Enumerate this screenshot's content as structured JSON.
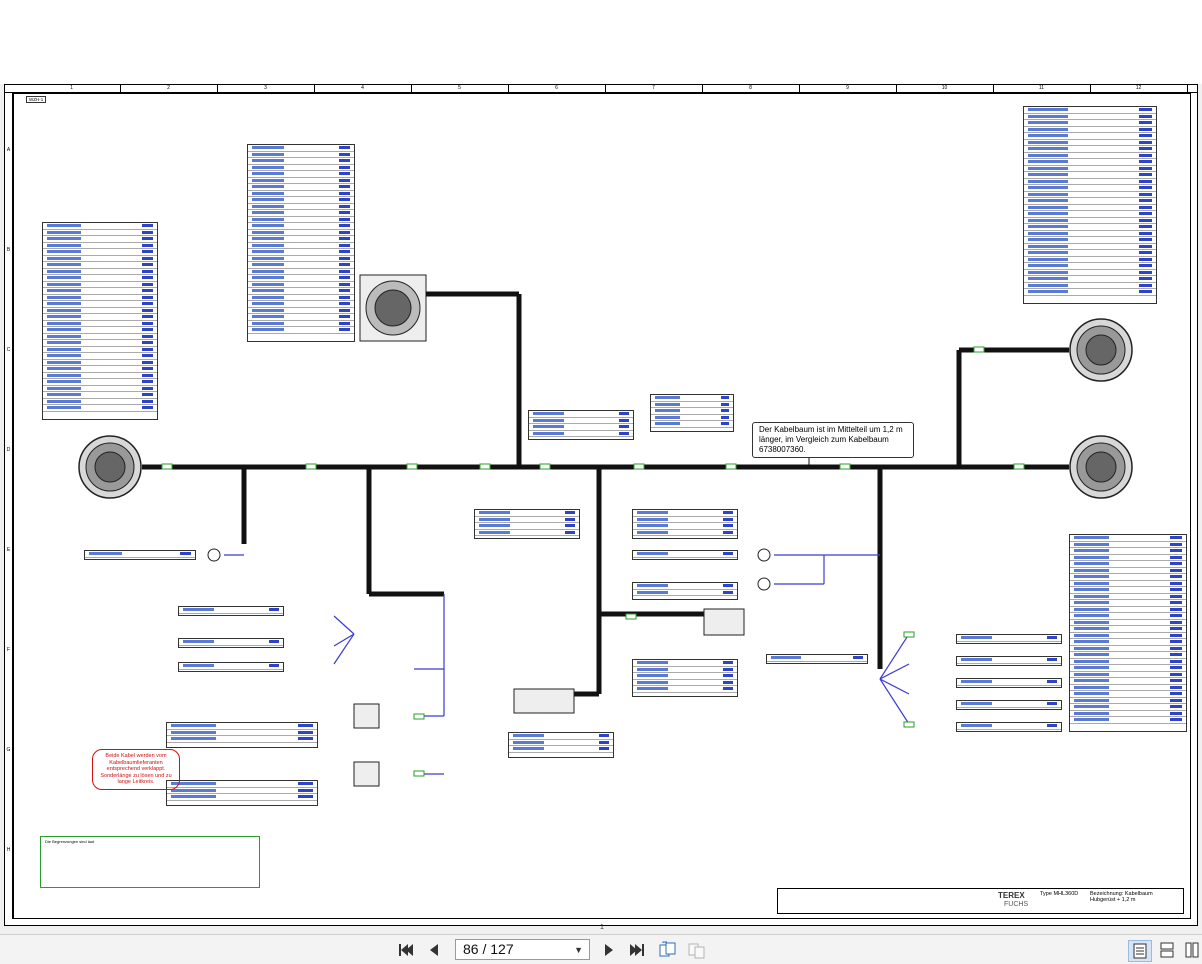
{
  "viewer": {
    "sheet_label": "WZH-1",
    "column_numbers": [
      "1",
      "2",
      "3",
      "4",
      "5",
      "6",
      "7",
      "8",
      "9",
      "10",
      "11",
      "12"
    ],
    "row_letters": [
      "A",
      "B",
      "C",
      "D",
      "E",
      "F",
      "G",
      "H"
    ],
    "note_callout": "Der Kabelbaum ist im Mittelteil um 1,2 m länger, im Vergleich zum Kabelbaum 6738007360.",
    "red_note": "Beide Kabel werden vom Kabelbaumlieferanten entsprechend verklappt. Sonderlänge zu lösen und zu lange Leitkreis.",
    "title_block": {
      "brand": "TEREX",
      "brand_sub": "FUCHS",
      "type_label": "Type",
      "type_value": "MHL360D",
      "description_label": "Bezeichnung: Kabelbaum",
      "description_value": "Hubgerüst + 1,2 m"
    },
    "legend_title": "Die Begrenzungen sind laut"
  },
  "toolbar": {
    "page_display": "86 / 127",
    "page_tick": "1",
    "first_page_icon": "first-page-icon",
    "prev_page_icon": "prev-page-icon",
    "next_page_icon": "next-page-icon",
    "last_page_icon": "last-page-icon"
  },
  "colors": {
    "cable": "#111111",
    "wire": "#3b3bd1",
    "tag": "#2b9c2b",
    "accent_red": "#d01010"
  }
}
